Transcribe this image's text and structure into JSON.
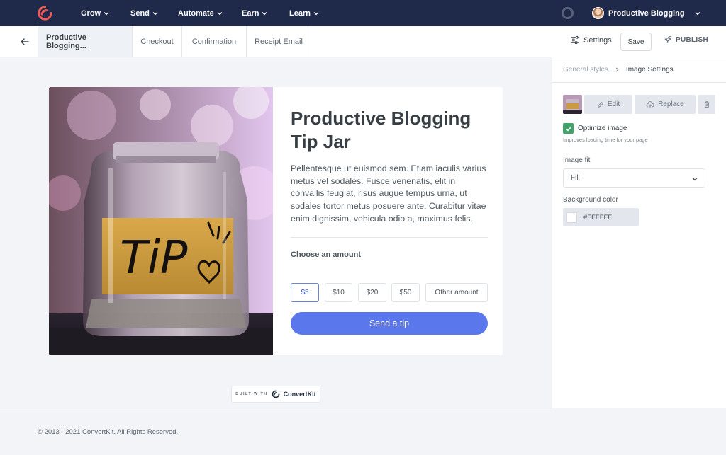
{
  "topnav": {
    "items": [
      {
        "label": "Grow"
      },
      {
        "label": "Send"
      },
      {
        "label": "Automate"
      },
      {
        "label": "Earn"
      },
      {
        "label": "Learn"
      }
    ],
    "account": "Productive Blogging"
  },
  "subbar": {
    "tabs": [
      {
        "label": "Productive Blogging..."
      },
      {
        "label": "Checkout"
      },
      {
        "label": "Confirmation"
      },
      {
        "label": "Receipt Email"
      }
    ],
    "settings_label": "Settings",
    "save_label": "Save",
    "publish_label": "PUBLISH"
  },
  "card": {
    "title": "Productive Blogging Tip Jar",
    "body": "Pellentesque ut euismod sem. Etiam iaculis varius metus vel sodales. Fusce venenatis, elit in convallis feugiat, risus augue tempus urna, ut sodales tortor metus posuere ante. Curabitur vitae enim dignissim, vehicula odio a, maximus felis.",
    "amount_label": "Choose an amount",
    "amounts": [
      {
        "label": "$5"
      },
      {
        "label": "$10"
      },
      {
        "label": "$20"
      },
      {
        "label": "$50"
      },
      {
        "label": "Other amount"
      }
    ],
    "selected_amount": "$5",
    "send_label": "Send a tip",
    "photo_text": "TiP"
  },
  "badge": {
    "built_with": "BUILT WITH",
    "brand": "ConvertKit"
  },
  "footer": {
    "copyright": "© 2013 - 2021 ConvertKit. All Rights Reserved."
  },
  "panel": {
    "breadcrumb_parent": "General styles",
    "breadcrumb_current": "Image Settings",
    "edit_label": "Edit",
    "replace_label": "Replace",
    "optimize_label": "Optimize image",
    "optimize_checked": true,
    "optimize_help": "Improves loading time for your page",
    "image_fit_label": "Image fit",
    "image_fit_value": "Fill",
    "bg_color_label": "Background color",
    "bg_color_value": "#FFFFFF"
  },
  "colors": {
    "nav_bg": "#1f2a4a",
    "accent": "#5a77ec",
    "check": "#3fa36a",
    "logo": "#f25a5a"
  }
}
